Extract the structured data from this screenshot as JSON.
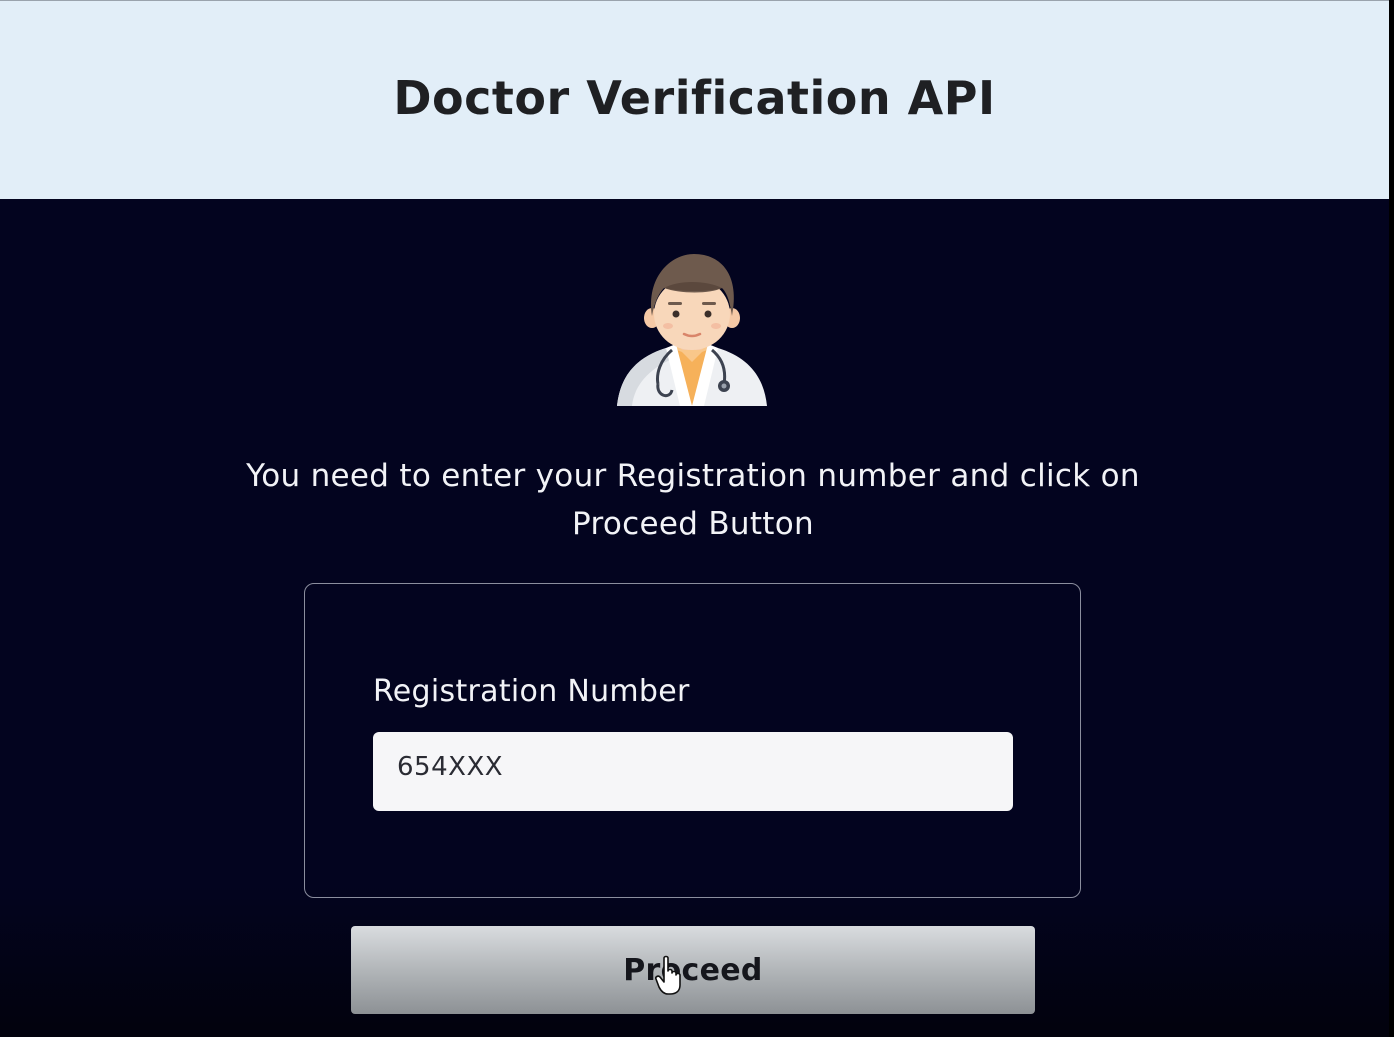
{
  "header": {
    "title": "Doctor Verification API"
  },
  "main": {
    "instruction": "You need to enter your Registration number and click on Proceed Button",
    "avatar_icon": "doctor-avatar-icon"
  },
  "form": {
    "label": "Registration Number",
    "input_value": "654XXX"
  },
  "actions": {
    "proceed_label": "Proceed"
  },
  "colors": {
    "header_background": "#e2eef8",
    "page_background": "#03041f",
    "button_background": "#aeb2b5",
    "text_light": "#f2f3f7"
  }
}
